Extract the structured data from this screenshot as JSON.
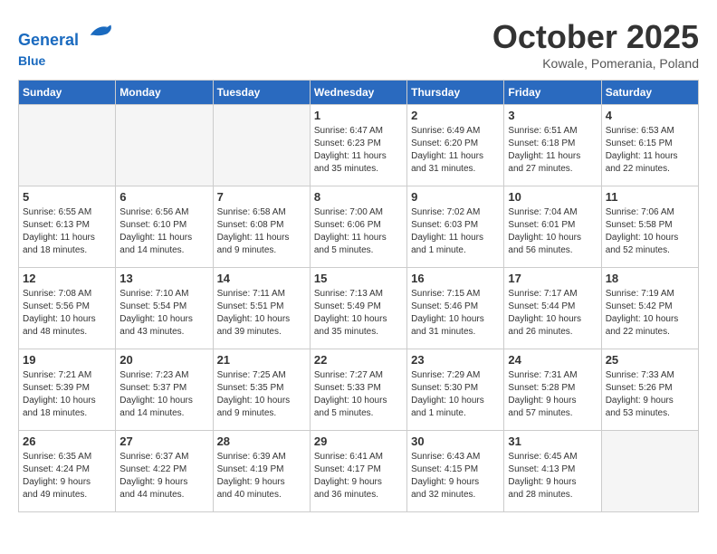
{
  "header": {
    "logo_line1": "General",
    "logo_line2": "Blue",
    "month": "October 2025",
    "location": "Kowale, Pomerania, Poland"
  },
  "weekdays": [
    "Sunday",
    "Monday",
    "Tuesday",
    "Wednesday",
    "Thursday",
    "Friday",
    "Saturday"
  ],
  "weeks": [
    [
      {
        "day": "",
        "info": ""
      },
      {
        "day": "",
        "info": ""
      },
      {
        "day": "",
        "info": ""
      },
      {
        "day": "1",
        "info": "Sunrise: 6:47 AM\nSunset: 6:23 PM\nDaylight: 11 hours\nand 35 minutes."
      },
      {
        "day": "2",
        "info": "Sunrise: 6:49 AM\nSunset: 6:20 PM\nDaylight: 11 hours\nand 31 minutes."
      },
      {
        "day": "3",
        "info": "Sunrise: 6:51 AM\nSunset: 6:18 PM\nDaylight: 11 hours\nand 27 minutes."
      },
      {
        "day": "4",
        "info": "Sunrise: 6:53 AM\nSunset: 6:15 PM\nDaylight: 11 hours\nand 22 minutes."
      }
    ],
    [
      {
        "day": "5",
        "info": "Sunrise: 6:55 AM\nSunset: 6:13 PM\nDaylight: 11 hours\nand 18 minutes."
      },
      {
        "day": "6",
        "info": "Sunrise: 6:56 AM\nSunset: 6:10 PM\nDaylight: 11 hours\nand 14 minutes."
      },
      {
        "day": "7",
        "info": "Sunrise: 6:58 AM\nSunset: 6:08 PM\nDaylight: 11 hours\nand 9 minutes."
      },
      {
        "day": "8",
        "info": "Sunrise: 7:00 AM\nSunset: 6:06 PM\nDaylight: 11 hours\nand 5 minutes."
      },
      {
        "day": "9",
        "info": "Sunrise: 7:02 AM\nSunset: 6:03 PM\nDaylight: 11 hours\nand 1 minute."
      },
      {
        "day": "10",
        "info": "Sunrise: 7:04 AM\nSunset: 6:01 PM\nDaylight: 10 hours\nand 56 minutes."
      },
      {
        "day": "11",
        "info": "Sunrise: 7:06 AM\nSunset: 5:58 PM\nDaylight: 10 hours\nand 52 minutes."
      }
    ],
    [
      {
        "day": "12",
        "info": "Sunrise: 7:08 AM\nSunset: 5:56 PM\nDaylight: 10 hours\nand 48 minutes."
      },
      {
        "day": "13",
        "info": "Sunrise: 7:10 AM\nSunset: 5:54 PM\nDaylight: 10 hours\nand 43 minutes."
      },
      {
        "day": "14",
        "info": "Sunrise: 7:11 AM\nSunset: 5:51 PM\nDaylight: 10 hours\nand 39 minutes."
      },
      {
        "day": "15",
        "info": "Sunrise: 7:13 AM\nSunset: 5:49 PM\nDaylight: 10 hours\nand 35 minutes."
      },
      {
        "day": "16",
        "info": "Sunrise: 7:15 AM\nSunset: 5:46 PM\nDaylight: 10 hours\nand 31 minutes."
      },
      {
        "day": "17",
        "info": "Sunrise: 7:17 AM\nSunset: 5:44 PM\nDaylight: 10 hours\nand 26 minutes."
      },
      {
        "day": "18",
        "info": "Sunrise: 7:19 AM\nSunset: 5:42 PM\nDaylight: 10 hours\nand 22 minutes."
      }
    ],
    [
      {
        "day": "19",
        "info": "Sunrise: 7:21 AM\nSunset: 5:39 PM\nDaylight: 10 hours\nand 18 minutes."
      },
      {
        "day": "20",
        "info": "Sunrise: 7:23 AM\nSunset: 5:37 PM\nDaylight: 10 hours\nand 14 minutes."
      },
      {
        "day": "21",
        "info": "Sunrise: 7:25 AM\nSunset: 5:35 PM\nDaylight: 10 hours\nand 9 minutes."
      },
      {
        "day": "22",
        "info": "Sunrise: 7:27 AM\nSunset: 5:33 PM\nDaylight: 10 hours\nand 5 minutes."
      },
      {
        "day": "23",
        "info": "Sunrise: 7:29 AM\nSunset: 5:30 PM\nDaylight: 10 hours\nand 1 minute."
      },
      {
        "day": "24",
        "info": "Sunrise: 7:31 AM\nSunset: 5:28 PM\nDaylight: 9 hours\nand 57 minutes."
      },
      {
        "day": "25",
        "info": "Sunrise: 7:33 AM\nSunset: 5:26 PM\nDaylight: 9 hours\nand 53 minutes."
      }
    ],
    [
      {
        "day": "26",
        "info": "Sunrise: 6:35 AM\nSunset: 4:24 PM\nDaylight: 9 hours\nand 49 minutes."
      },
      {
        "day": "27",
        "info": "Sunrise: 6:37 AM\nSunset: 4:22 PM\nDaylight: 9 hours\nand 44 minutes."
      },
      {
        "day": "28",
        "info": "Sunrise: 6:39 AM\nSunset: 4:19 PM\nDaylight: 9 hours\nand 40 minutes."
      },
      {
        "day": "29",
        "info": "Sunrise: 6:41 AM\nSunset: 4:17 PM\nDaylight: 9 hours\nand 36 minutes."
      },
      {
        "day": "30",
        "info": "Sunrise: 6:43 AM\nSunset: 4:15 PM\nDaylight: 9 hours\nand 32 minutes."
      },
      {
        "day": "31",
        "info": "Sunrise: 6:45 AM\nSunset: 4:13 PM\nDaylight: 9 hours\nand 28 minutes."
      },
      {
        "day": "",
        "info": ""
      }
    ]
  ]
}
